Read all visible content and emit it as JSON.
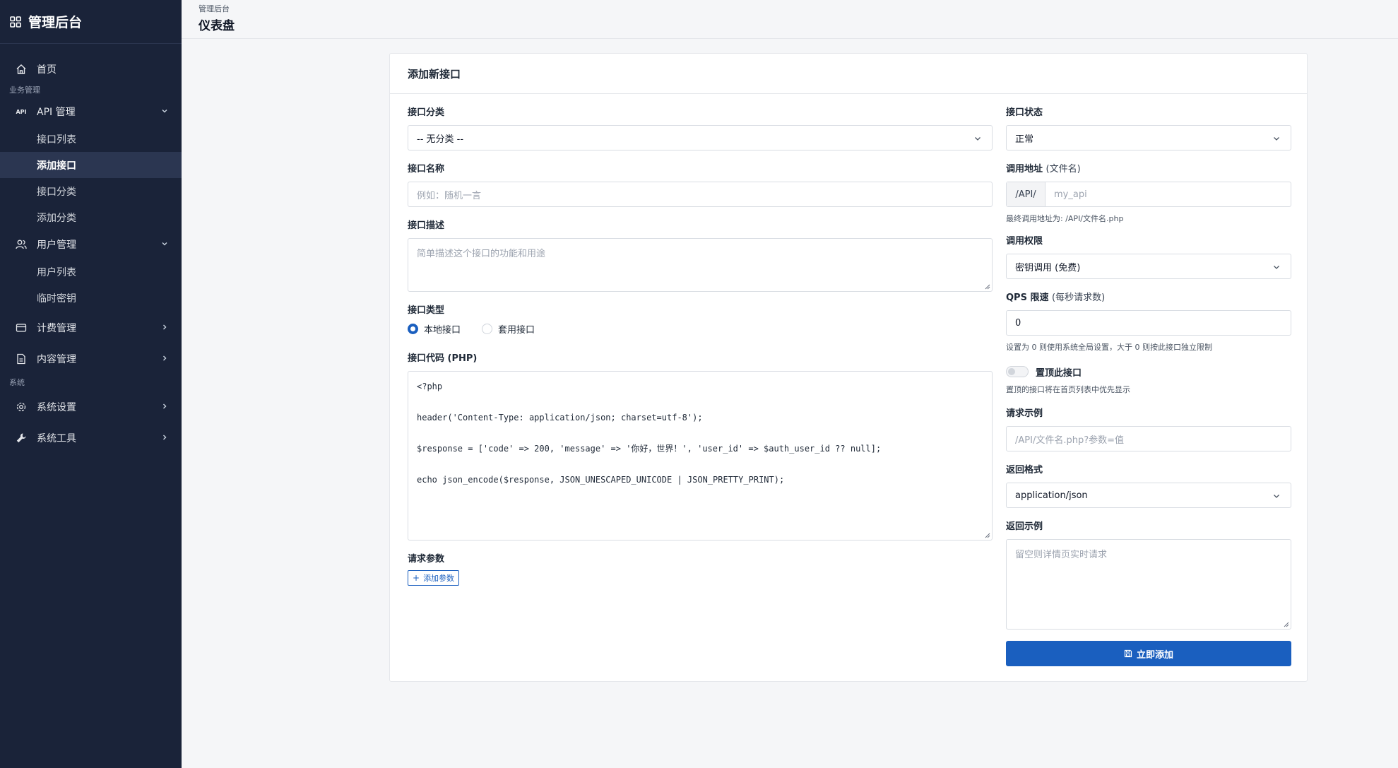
{
  "brand": {
    "title": "管理后台"
  },
  "nav": {
    "home": "首页",
    "section_business": "业务管理",
    "api_group": "API 管理",
    "api_items": [
      "接口列表",
      "添加接口",
      "接口分类",
      "添加分类"
    ],
    "user_group": "用户管理",
    "user_items": [
      "用户列表",
      "临时密钥"
    ],
    "billing": "计费管理",
    "content": "内容管理",
    "section_system": "系统",
    "settings": "系统设置",
    "tools": "系统工具"
  },
  "header": {
    "breadcrumb": "管理后台",
    "title": "仪表盘"
  },
  "card": {
    "title": "添加新接口"
  },
  "form": {
    "category_label": "接口分类",
    "category_value": "-- 无分类 --",
    "name_label": "接口名称",
    "name_placeholder": "例如：随机一言",
    "desc_label": "接口描述",
    "desc_placeholder": "简单描述这个接口的功能和用途",
    "type_label": "接口类型",
    "type_options": [
      "本地接口",
      "套用接口"
    ],
    "code_label": "接口代码 (PHP)",
    "code_lines": [
      "<?php",
      "",
      "header('Content-Type: application/json; charset=utf-8');",
      "",
      "$response = ['code' => 200, 'message' => '你好，世界！', 'user_id' => $auth_user_id ?? null];",
      "",
      "echo json_encode($response, JSON_UNESCAPED_UNICODE | JSON_PRETTY_PRINT);"
    ],
    "params_label": "请求参数",
    "add_param_label": "添加参数",
    "status_label": "接口状态",
    "status_value": "正常",
    "url_label": "调用地址",
    "url_label_hint": "(文件名)",
    "url_prefix": "/API/",
    "url_placeholder": "my_api",
    "url_help": "最终调用地址为: /API/文件名.php",
    "perm_label": "调用权限",
    "perm_value": "密钥调用 (免费)",
    "qps_label": "QPS 限速",
    "qps_hint": "(每秒请求数)",
    "qps_value": "0",
    "qps_help": "设置为 0 则使用系统全局设置，大于 0 则按此接口独立限制",
    "pin_label": "置顶此接口",
    "pin_help": "置顶的接口将在首页列表中优先显示",
    "example_label": "请求示例",
    "example_placeholder": "/API/文件名.php?参数=值",
    "format_label": "返回格式",
    "format_value": "application/json",
    "return_label": "返回示例",
    "return_placeholder": "留空则详情页实时请求",
    "submit_label": "立即添加"
  }
}
